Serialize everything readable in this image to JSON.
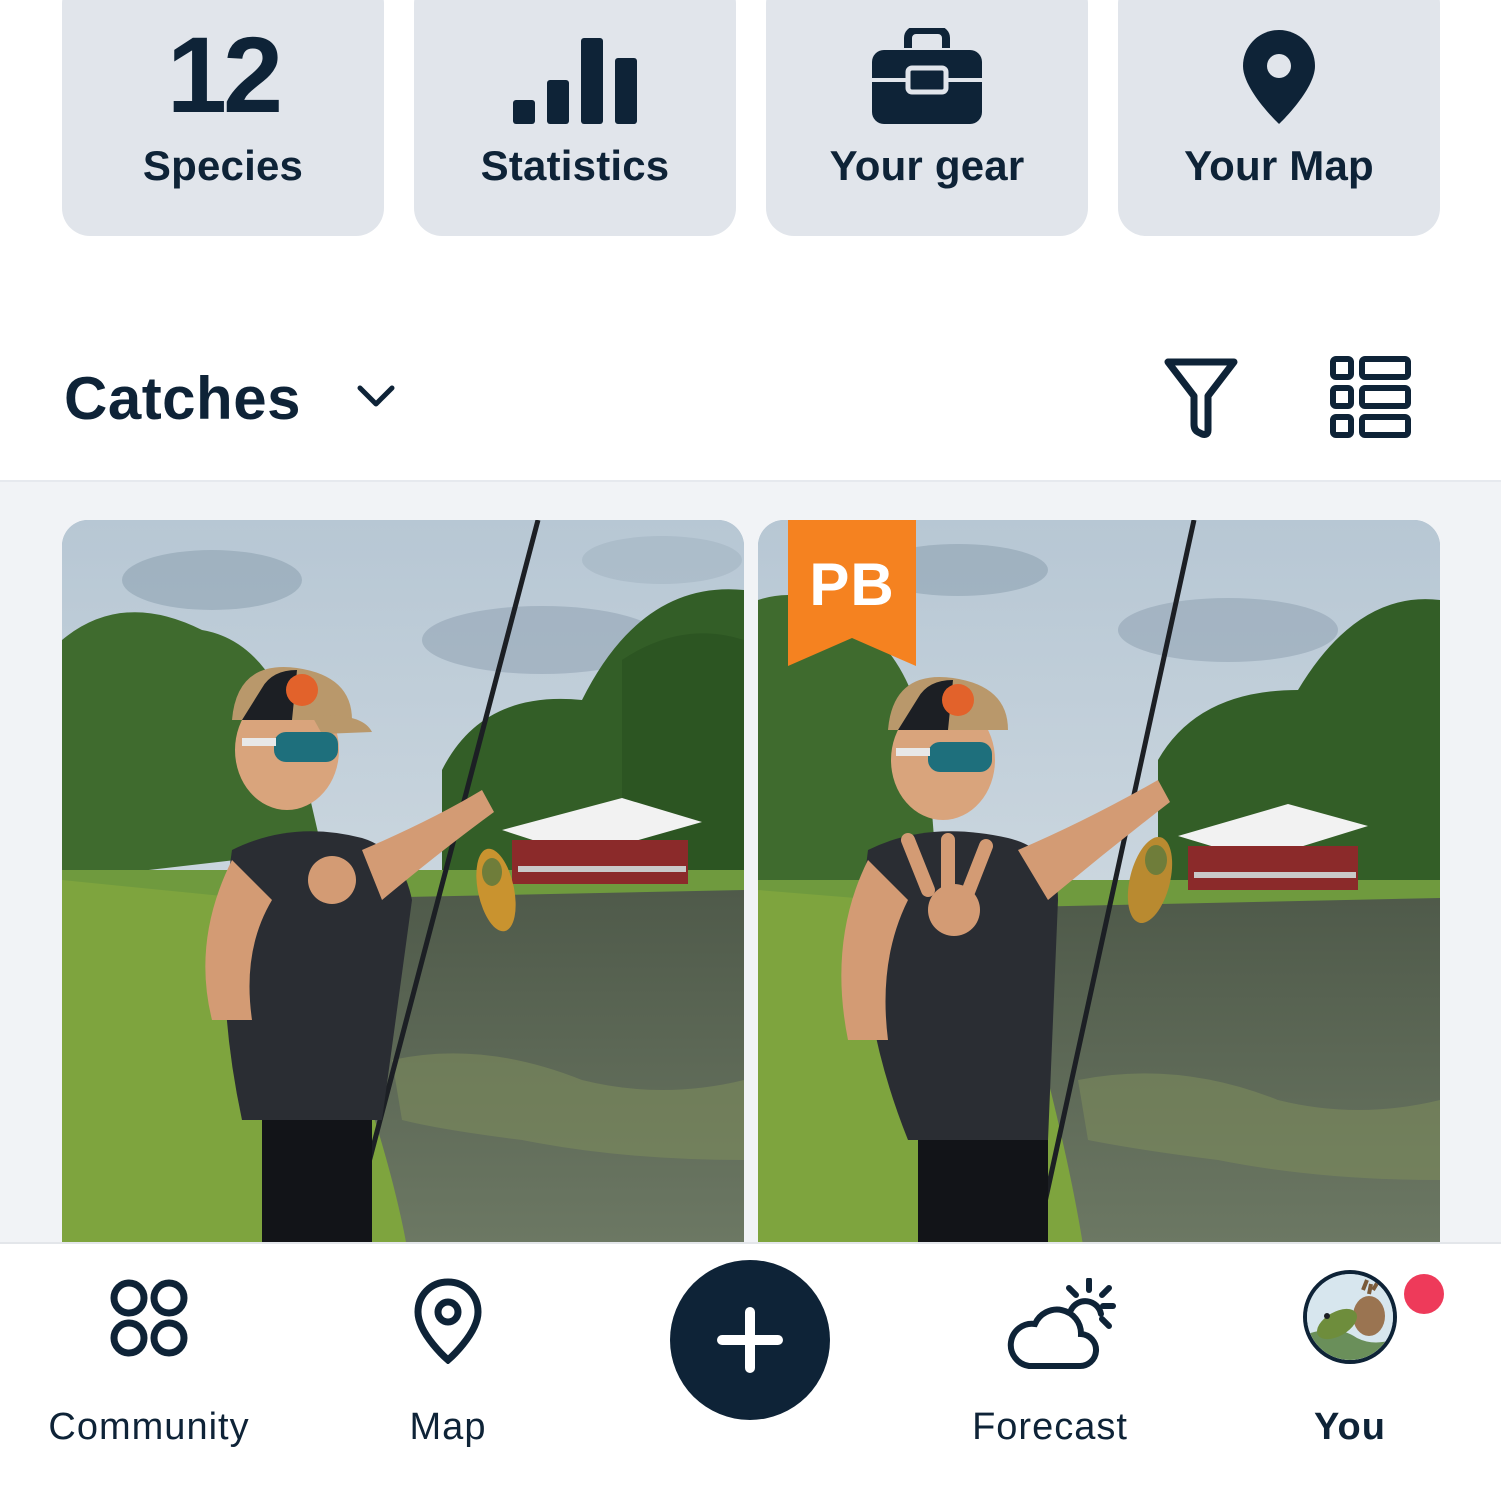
{
  "tiles": [
    {
      "label": "Species",
      "value": "12",
      "icon": "species-count"
    },
    {
      "label": "Statistics",
      "icon": "bar-chart-icon"
    },
    {
      "label": "Your gear",
      "icon": "tackle-box-icon"
    },
    {
      "label": "Your Map",
      "icon": "map-pin-icon"
    }
  ],
  "catches": {
    "title": "Catches",
    "icons": {
      "dropdown": "chevron-down-icon",
      "filter": "filter-icon",
      "layout": "list-layout-icon"
    },
    "items": [
      {
        "badge": null,
        "image": "boy-holding-fish-by-pond"
      },
      {
        "badge": "PB",
        "badge_color": "#f58220",
        "image": "boy-holding-fish-by-pond"
      }
    ]
  },
  "nav": {
    "items": [
      {
        "label": "Community",
        "icon": "community-grid-icon",
        "active": false
      },
      {
        "label": "Map",
        "icon": "map-pin-outline-icon",
        "active": false
      },
      {
        "label": "",
        "icon": "plus-icon",
        "active": false
      },
      {
        "label": "Forecast",
        "icon": "weather-cloud-sun-icon",
        "active": false
      },
      {
        "label": "You",
        "icon": "avatar",
        "active": true
      }
    ],
    "notification_dot_color": "#ee3a5a"
  },
  "colors": {
    "primary": "#0e2337",
    "tile_bg": "#e1e5eb",
    "accent": "#f58220"
  }
}
